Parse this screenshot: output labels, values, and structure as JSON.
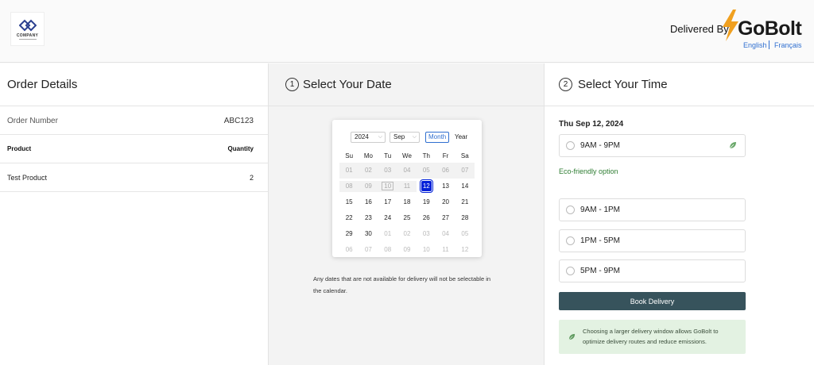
{
  "header": {
    "company_logo_text": "COMPANY",
    "delivered_by": "Delivered By",
    "brand": "GoBolt",
    "languages": [
      "English",
      "Français"
    ]
  },
  "order": {
    "title": "Order Details",
    "order_number_label": "Order Number",
    "order_number": "ABC123",
    "product_header": "Product",
    "quantity_header": "Quantity",
    "items": [
      {
        "product": "Test Product",
        "quantity": "2"
      }
    ]
  },
  "date_step": {
    "number": "1",
    "title": "Select Your Date",
    "calendar": {
      "year": "2024",
      "month": "Sep",
      "mode_month": "Month",
      "mode_year": "Year",
      "weekdays": [
        "Su",
        "Mo",
        "Tu",
        "We",
        "Th",
        "Fr",
        "Sa"
      ],
      "weeks": [
        [
          "01",
          "02",
          "03",
          "04",
          "05",
          "06",
          "07"
        ],
        [
          "08",
          "09",
          "10",
          "11",
          "12",
          "13",
          "14"
        ],
        [
          "15",
          "16",
          "17",
          "18",
          "19",
          "20",
          "21"
        ],
        [
          "22",
          "23",
          "24",
          "25",
          "26",
          "27",
          "28"
        ],
        [
          "29",
          "30",
          "01",
          "02",
          "03",
          "04",
          "05"
        ],
        [
          "06",
          "07",
          "08",
          "09",
          "10",
          "11",
          "12"
        ]
      ],
      "selected": "12",
      "today": "10"
    },
    "note": "Any dates that are not available for delivery will not be selectable in the calendar."
  },
  "time_step": {
    "number": "2",
    "title": "Select Your Time",
    "date_label": "Thu Sep 12, 2024",
    "eco_slot": "9AM - 9PM",
    "eco_label": "Eco-friendly option",
    "slots": [
      "9AM - 1PM",
      "1PM - 5PM",
      "5PM - 9PM"
    ],
    "book_button": "Book Delivery",
    "info": "Choosing a larger delivery window allows GoBolt to optimize delivery routes and reduce emissions."
  },
  "colors": {
    "accent_blue": "#0020d8",
    "button_bg": "#37535c",
    "eco_green": "#2e7d32",
    "info_bg": "#e3f2e2",
    "bolt_orange": "#f0a020"
  },
  "icons": [
    "company-logo-icon",
    "lightning-bolt-icon",
    "leaf-icon"
  ]
}
